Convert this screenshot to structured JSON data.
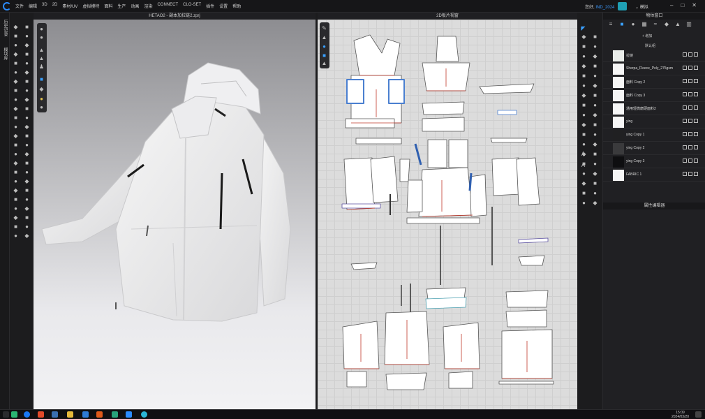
{
  "menubar": {
    "items": [
      "文件",
      "编辑",
      "3D",
      "2D",
      "素材/UV",
      "虚拟模特",
      "面料",
      "生产",
      "动画",
      "渲染",
      "CONNECT",
      "CLO-SET",
      "插件",
      "设置",
      "帮助"
    ],
    "greeting": "您好,",
    "username": "IND_2024",
    "mode": "模拟"
  },
  "left_tabs": [
    "历史记录",
    "模块库"
  ],
  "viewport3d": {
    "title": "HETAO2 - 副本加拉链2.zprj"
  },
  "viewport2d": {
    "title": "2D板片视窗"
  },
  "object_panel": {
    "title": "物体窗口",
    "add_label": "+ 增加",
    "group_label": "默认组",
    "items": [
      {
        "name": "拉链",
        "swatch": "#e9ece9"
      },
      {
        "name": "Sherpa_Fleece_Poly_275gsm",
        "swatch": "#f6f6f6"
      },
      {
        "name": "面料 Copy 2",
        "swatch": "#f6f6f6"
      },
      {
        "name": "面料 Copy 3",
        "swatch": "#f6f6f6"
      },
      {
        "name": "通用轻微磨硬面料2",
        "swatch": "#f6f6f6"
      },
      {
        "name": "ying",
        "swatch": "#f6f6f6"
      },
      {
        "name": "ying Copy 1",
        "swatch": "#202022"
      },
      {
        "name": "ying Copy 2",
        "swatch": "#3a3a3c"
      },
      {
        "name": "ying Copy 3",
        "swatch": "#0e0e10"
      },
      {
        "name": "FABRIC 1",
        "swatch": "#f6f6f6"
      }
    ]
  },
  "property_panel": {
    "title": "属性编辑器"
  },
  "taskbar": {
    "time": "15:09",
    "date": "2024/03/20"
  },
  "colors": {
    "accent": "#2b8cff",
    "pattern_line": "#c0392b",
    "viewport2d_bg": "#dcdcdc"
  }
}
